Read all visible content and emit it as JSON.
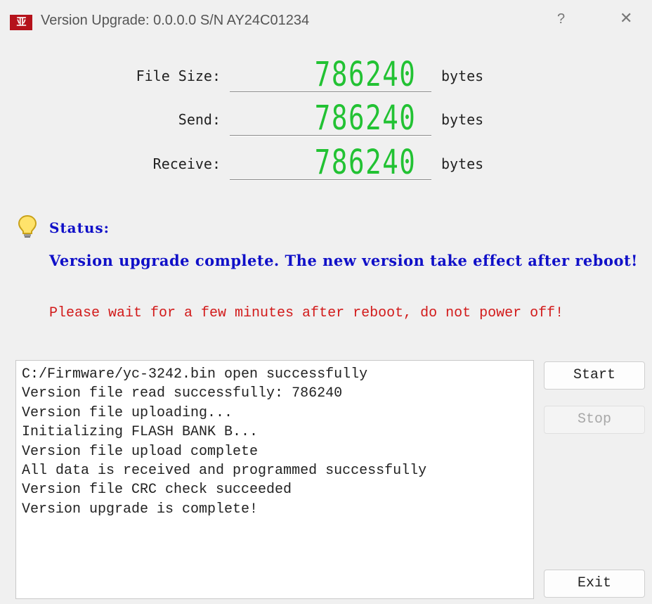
{
  "window": {
    "app_icon_text": "亚",
    "title": "Version Upgrade: 0.0.0.0  S/N AY24C01234",
    "help_label": "?",
    "close_label": "✕"
  },
  "counters": [
    {
      "label": "File Size:",
      "value": "786240",
      "unit": "bytes"
    },
    {
      "label": "Send:",
      "value": "786240",
      "unit": "bytes"
    },
    {
      "label": "Receive:",
      "value": "786240",
      "unit": "bytes"
    }
  ],
  "status": {
    "icon": "lightbulb-icon",
    "label": "Status:",
    "message": "Version upgrade complete. The new version take effect after reboot!",
    "warning": "Please wait for a few minutes after reboot, do not power off!"
  },
  "log": [
    "C:/Firmware/yc-3242.bin open successfully",
    "Version file read successfully: 786240",
    "Version file uploading...",
    "Initializing FLASH BANK B...",
    "Version file upload complete",
    "All data is received and programmed successfully",
    "Version file CRC check succeeded",
    "Version upgrade is complete!"
  ],
  "buttons": {
    "start": "Start",
    "stop": "Stop",
    "exit": "Exit"
  },
  "colors": {
    "lcd_digits": "#22c233",
    "status_blue": "#1010c8",
    "warning_red": "#d21a1a",
    "app_icon_bg": "#b5121b"
  }
}
